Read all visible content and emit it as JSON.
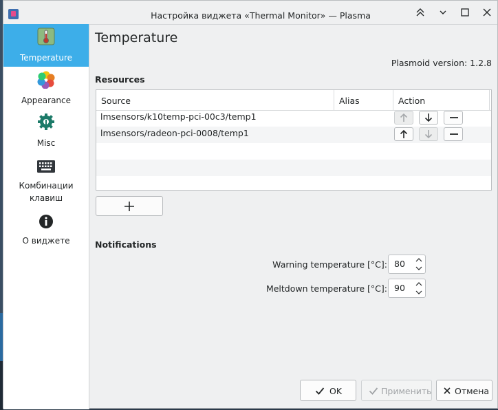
{
  "window": {
    "title": "Настройка виджета «Thermal Monitor» — Plasma",
    "controls": [
      "keep-above",
      "minimize",
      "maximize",
      "close"
    ]
  },
  "sidebar": {
    "items": [
      {
        "label": "Temperature",
        "icon": "thermometer-icon",
        "active": true
      },
      {
        "label": "Appearance",
        "icon": "color-palette-icon",
        "active": false
      },
      {
        "label": "Misc",
        "icon": "settings-gear-icon",
        "active": false
      },
      {
        "label": "Комбинации клавиш",
        "icon": "keyboard-icon",
        "active": false
      },
      {
        "label": "О виджете",
        "icon": "info-icon",
        "active": false
      }
    ]
  },
  "page": {
    "title": "Temperature",
    "version": "Plasmoid version: 1.2.8"
  },
  "resources": {
    "title": "Resources",
    "columns": [
      "Source",
      "Alias",
      "Action"
    ],
    "rows": [
      {
        "source": "lmsensors/k10temp-pci-00c3/temp1",
        "alias": "",
        "up_enabled": false,
        "down_enabled": true
      },
      {
        "source": "lmsensors/radeon-pci-0008/temp1",
        "alias": "",
        "up_enabled": true,
        "down_enabled": false
      }
    ],
    "add_icon": "plus-icon"
  },
  "notifications": {
    "title": "Notifications",
    "warning_label": "Warning temperature [°C]:",
    "warning_value": "80",
    "meltdown_label": "Meltdown temperature [°C]:",
    "meltdown_value": "90"
  },
  "buttons": {
    "ok": "OK",
    "apply": "Применить",
    "cancel": "Отмена"
  },
  "colors": {
    "accent": "#3daee9",
    "window_bg": "#eff0f1"
  }
}
